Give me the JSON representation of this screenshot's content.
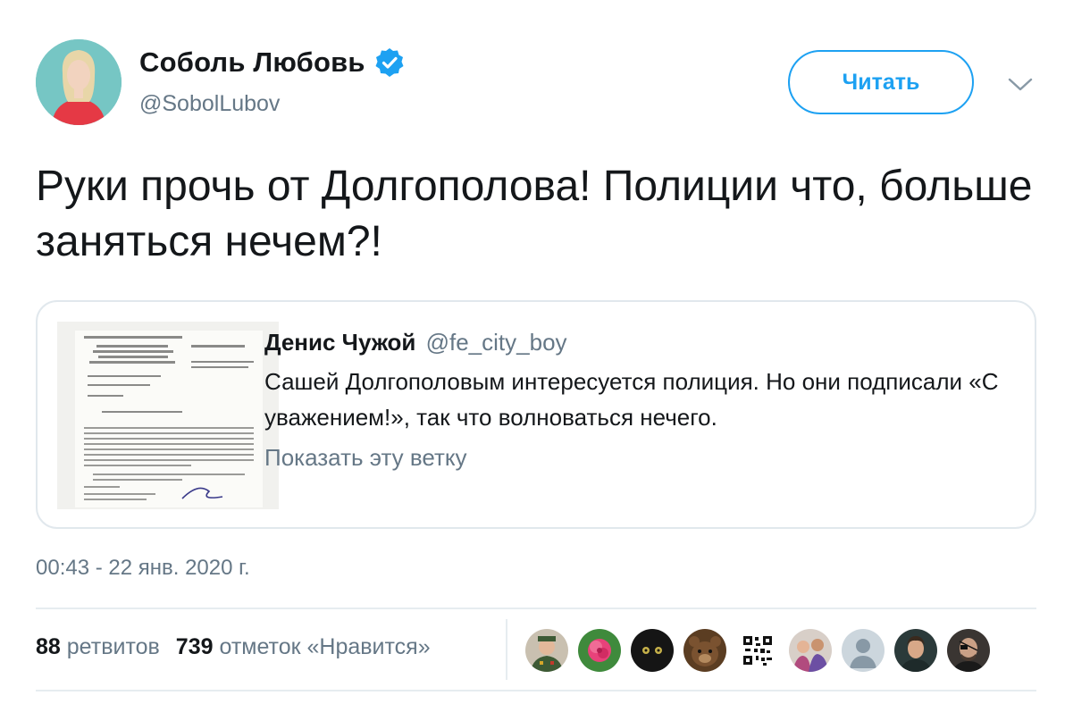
{
  "author": {
    "name": "Соболь Любовь",
    "handle": "@SobolLubov",
    "verified": true
  },
  "follow_button": {
    "label": "Читать"
  },
  "tweet": {
    "text": "Руки прочь от Долгополова! Полиции что, больше заняться нечем?!"
  },
  "quoted_tweet": {
    "author_name": "Денис Чужой",
    "author_handle": "@fe_city_boy",
    "text": "Сашей Долгополовым интересуется полиция. Но они подписали «С уважением!», так что волноваться нечего.",
    "show_thread": "Показать эту ветку"
  },
  "timestamp": "00:43 - 22 янв. 2020 г.",
  "stats": {
    "retweets_count": "88",
    "retweets_label": "ретвитов",
    "likes_count": "739",
    "likes_label": "отметок «Нравится»"
  },
  "colors": {
    "accent": "#1da1f2",
    "secondary_text": "#657786",
    "border": "#e1e8ed"
  },
  "likers": [
    {
      "icon": "military-officer-avatar"
    },
    {
      "icon": "pink-flower-avatar"
    },
    {
      "icon": "black-cat-avatar"
    },
    {
      "icon": "bear-avatar"
    },
    {
      "icon": "qr-code-avatar"
    },
    {
      "icon": "group-photo-avatar"
    },
    {
      "icon": "default-user-avatar"
    },
    {
      "icon": "man-portrait-avatar"
    },
    {
      "icon": "man-with-eyepatch-avatar"
    }
  ]
}
